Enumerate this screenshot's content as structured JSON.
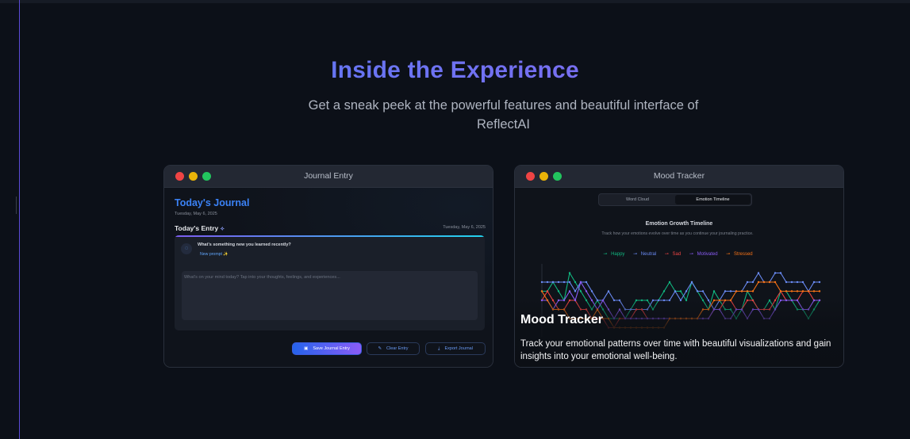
{
  "section": {
    "title": "Inside the Experience",
    "subtitle": "Get a sneak peek at the powerful features and beautiful interface of ReflectAI"
  },
  "journal_window": {
    "title": "Journal Entry",
    "heading": "Today's Journal",
    "date": "Tuesday, May 6, 2025",
    "entry_title": "Today's Entry",
    "entry_date": "Tuesday, May 6, 2025",
    "prompt_question": "What's something new you learned recently?",
    "new_prompt_label": "New prompt ✨",
    "textarea_placeholder": "What's on your mind today? Tap into your thoughts, feelings, and experiences...",
    "buttons": {
      "save": "Save Journal Entry",
      "clear": "Clear Entry",
      "export": "Export Journal"
    }
  },
  "mood_window": {
    "title": "Mood Tracker",
    "tabs": [
      "Word Cloud",
      "Emotion Timeline"
    ],
    "active_tab": "Emotion Timeline",
    "chart_title": "Emotion Growth Timeline",
    "chart_subtitle": "Track how your emotions evolve over time as you continue your journaling practice.",
    "legend": [
      {
        "name": "Happy",
        "color": "#10b981"
      },
      {
        "name": "Neutral",
        "color": "#6b8cf7"
      },
      {
        "name": "Sad",
        "color": "#ef4444"
      },
      {
        "name": "Motivated",
        "color": "#8b5cf6"
      },
      {
        "name": "Stressed",
        "color": "#f97316"
      }
    ],
    "overlay_title": "Mood Tracker",
    "overlay_desc": "Track your emotional patterns over time with beautiful visualizations and gain insights into your emotional well-being."
  },
  "chart_data": {
    "type": "line",
    "ylim": [
      0,
      4
    ],
    "series": [
      {
        "name": "Happy",
        "color": "#10b981",
        "values": [
          2.5,
          2.5,
          3,
          2.5,
          2,
          3.5,
          3,
          2.5,
          2,
          1.5,
          2,
          1.5,
          1,
          1,
          1,
          1,
          1.5,
          2,
          2,
          2,
          1.5,
          2,
          2.5,
          3,
          2.5,
          2.5,
          2,
          3,
          2.5,
          2,
          1.5,
          2.5,
          2,
          1.5,
          1.5,
          1,
          1.5,
          2.5,
          2,
          1.5,
          1.5,
          2,
          1.5,
          2.5,
          2.5,
          2,
          1.5,
          1.5,
          1,
          1.5,
          2
        ]
      },
      {
        "name": "Neutral",
        "color": "#6b8cf7",
        "values": [
          3,
          3,
          3,
          3,
          3,
          3,
          2.5,
          3,
          3,
          2.5,
          2,
          2,
          2.5,
          2,
          2,
          1.5,
          1.5,
          1.5,
          1.5,
          1.5,
          2,
          2,
          2,
          2,
          2.5,
          2,
          2.5,
          3,
          2.5,
          2.5,
          2,
          1.5,
          2,
          2.5,
          2.5,
          2.5,
          2.5,
          3,
          3,
          3.5,
          3,
          3,
          3.5,
          3.5,
          3,
          3,
          3,
          3,
          2.5,
          3,
          3
        ]
      },
      {
        "name": "Sad",
        "color": "#ef4444",
        "values": [
          2,
          2.5,
          2,
          1.5,
          1.5,
          2,
          2,
          1.5,
          1.5,
          1,
          1,
          1,
          0.5,
          0.5,
          1,
          1,
          1,
          1.5,
          1.5,
          1,
          1,
          1,
          1,
          1,
          1,
          1,
          1,
          1,
          1,
          1,
          1,
          1.5,
          1.5,
          2,
          2,
          1.5,
          1.5,
          2,
          2,
          1.5,
          1.5,
          1.5,
          2,
          2.5,
          2,
          2,
          2,
          2.5,
          2.5,
          2,
          2
        ]
      },
      {
        "name": "Motivated",
        "color": "#8b5cf6",
        "values": [
          2,
          2,
          1.5,
          2,
          2,
          2.5,
          2,
          3,
          2.5,
          2,
          1.5,
          2,
          1.5,
          1,
          1.5,
          1,
          1,
          1,
          1,
          1,
          1,
          1,
          1,
          1,
          1,
          1,
          1,
          1,
          1,
          1,
          1,
          1.5,
          1.5,
          1,
          1,
          1.5,
          1.5,
          1,
          1.5,
          1.5,
          1,
          1,
          1.5,
          2,
          2,
          2,
          2,
          1.5,
          1.5,
          2,
          2
        ]
      },
      {
        "name": "Stressed",
        "color": "#f97316",
        "values": [
          2.5,
          2,
          1.5,
          1.5,
          1.5,
          1,
          1,
          1,
          1,
          1,
          1.5,
          1,
          1,
          0.5,
          0.5,
          0.5,
          0.5,
          0.5,
          0.5,
          0.5,
          0.5,
          0.5,
          0.5,
          1,
          1,
          1,
          1,
          1,
          1,
          1.5,
          1.5,
          2,
          2,
          2,
          2,
          2.5,
          2.5,
          2.5,
          2.5,
          3,
          3,
          3,
          3,
          2.5,
          2.5,
          2.5,
          2.5,
          2.5,
          2.5,
          2.5,
          2.5
        ]
      }
    ]
  }
}
